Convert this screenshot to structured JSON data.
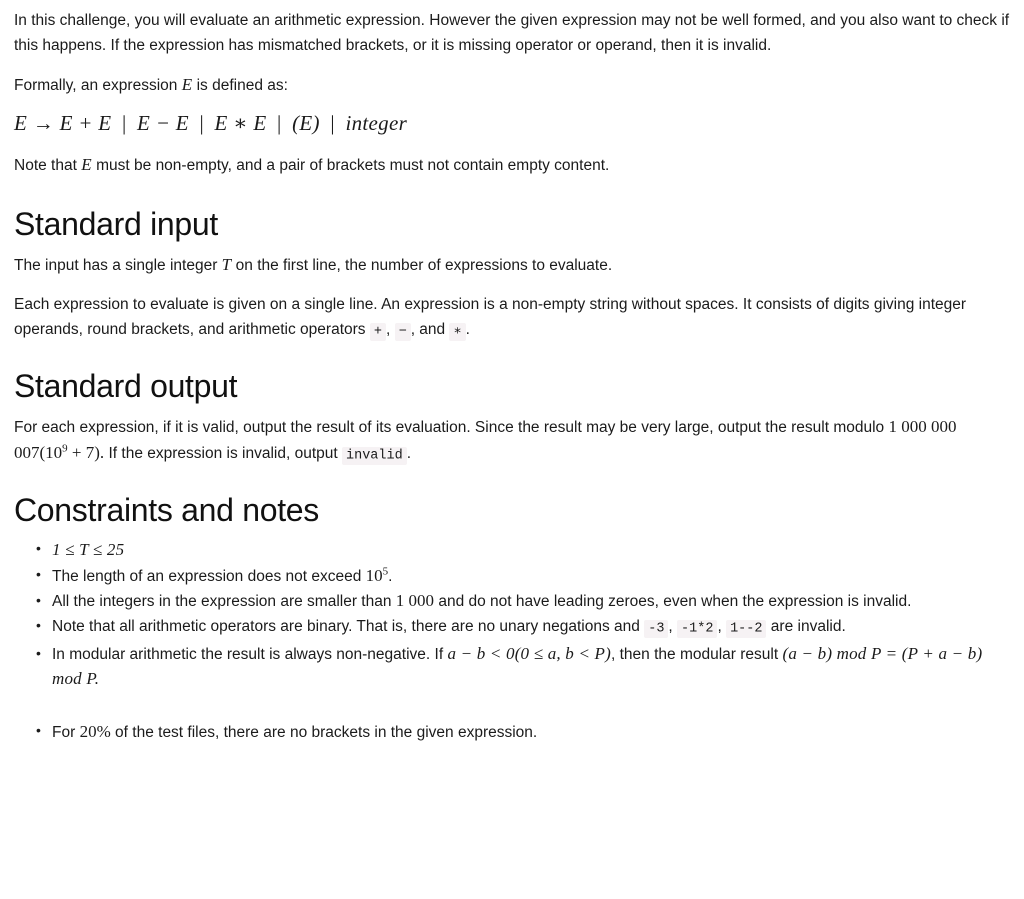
{
  "document": {
    "intro": {
      "paragraph1": "In this challenge, you will evaluate an arithmetic expression. However the given expression may not be well formed, and you also want to check if this happens. If the expression has mismatched brackets, or it is missing operator or operand, then it is invalid.",
      "paragraph2_prefix": "Formally, an expression",
      "paragraph2_symbol": "E",
      "paragraph2_suffix": "is defined as:",
      "grammar": {
        "lhs": "E",
        "arrow": "→",
        "alt1": "E + E",
        "alt2": "E − E",
        "alt3": "E ∗ E",
        "alt4": "(E)",
        "alt5": "integer",
        "separator": "|",
        "full": "E → E + E | E − E | E ∗ E | (E) | integer"
      },
      "note_prefix": "Note that",
      "note_symbol": "E",
      "note_suffix": "must be non-empty, and a pair of brackets must not contain empty content."
    },
    "standard_input": {
      "heading": "Standard input",
      "paragraph1_part1": "The input has a single integer",
      "paragraph1_symbol": "T",
      "paragraph1_part2": "on the first line, the number of expressions to evaluate.",
      "paragraph2_part1": "Each expression to evaluate is given on a single line. An expression is a non-empty string without spaces. It consists of digits giving integer operands, round brackets, and arithmetic operators",
      "operator_plus": "+",
      "operator_comma1": ",",
      "operator_minus": "−",
      "operator_comma2": ", and",
      "operator_times": "∗",
      "paragraph2_end": "."
    },
    "standard_output": {
      "heading": "Standard output",
      "paragraph1_part1": "For each expression, if it is valid, output the result of its evaluation. Since the result may be very large, output the result modulo",
      "modulus": "1 000 000 007",
      "modulus_paren_open": "(10",
      "modulus_exponent": "9",
      "modulus_plus": "+ 7",
      "modulus_paren_close": ").",
      "paragraph1_part2": "If the expression is invalid, output",
      "invalid_code": "invalid",
      "paragraph1_end": "."
    },
    "constraints": {
      "heading": "Constraints and notes",
      "items": [
        {
          "id": "t-range",
          "math": "1 ≤ T ≤ 25"
        },
        {
          "id": "expression-length",
          "text_part1": "The length of an expression does not exceed",
          "math_base": "10",
          "math_exponent": "5",
          "text_part2": "."
        },
        {
          "id": "integer-bounds",
          "text_part1": "All the integers in the expression are smaller than",
          "math": "1 000",
          "text_part2": "and do not have leading zeroes, even when the expression is invalid."
        },
        {
          "id": "binary-operators",
          "text_part1": "Note that all arithmetic operators are binary. That is, there are no unary negations and",
          "code1": "-3",
          "sep1": ",",
          "code2": "-1*2",
          "sep2": ",",
          "code3": "1--2",
          "text_part2": "are invalid."
        },
        {
          "id": "modular-arithmetic",
          "text_part1": "In modular arithmetic the result is always non-negative. If",
          "math1": "a − b < 0(0 ≤ a, b < P)",
          "text_part2": ", then the modular result",
          "math2": "(a − b) mod P = (P + a − b) mod P."
        },
        {
          "id": "no-brackets-subtask",
          "text_part1": "For",
          "math": "20%",
          "text_part2": "of the test files, there are no brackets in the given expression."
        }
      ]
    }
  },
  "colors": {
    "text": "#1b1b1b",
    "heading": "#111111",
    "code_background": "#f6f2f4",
    "page_background": "#ffffff"
  }
}
